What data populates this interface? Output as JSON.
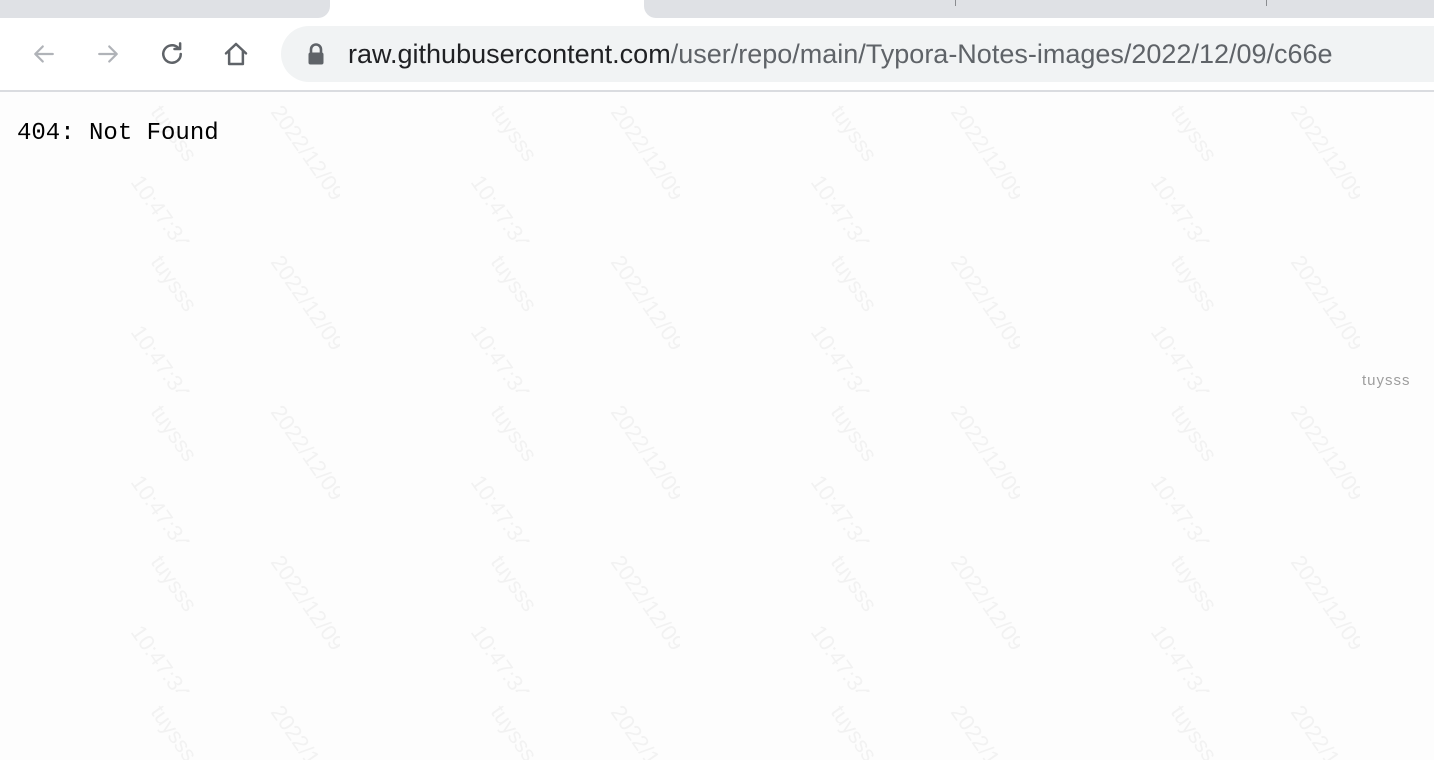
{
  "browser": {
    "toolbar": {
      "back_icon": "back-arrow-icon",
      "forward_icon": "forward-arrow-icon",
      "reload_icon": "reload-icon",
      "home_icon": "home-icon"
    },
    "omnibox": {
      "secure_icon": "lock-icon",
      "url_host": "raw.githubusercontent.com",
      "url_path": "/user/repo/main/Typora-Notes-images/2022/12/09/c66e"
    }
  },
  "page": {
    "message": "404: Not Found",
    "watermark_user": "tuysss"
  },
  "colors": {
    "tabstrip": "#dfe1e5",
    "omnibox_bg": "#f1f3f4",
    "page_bg": "#fdfdfd"
  }
}
